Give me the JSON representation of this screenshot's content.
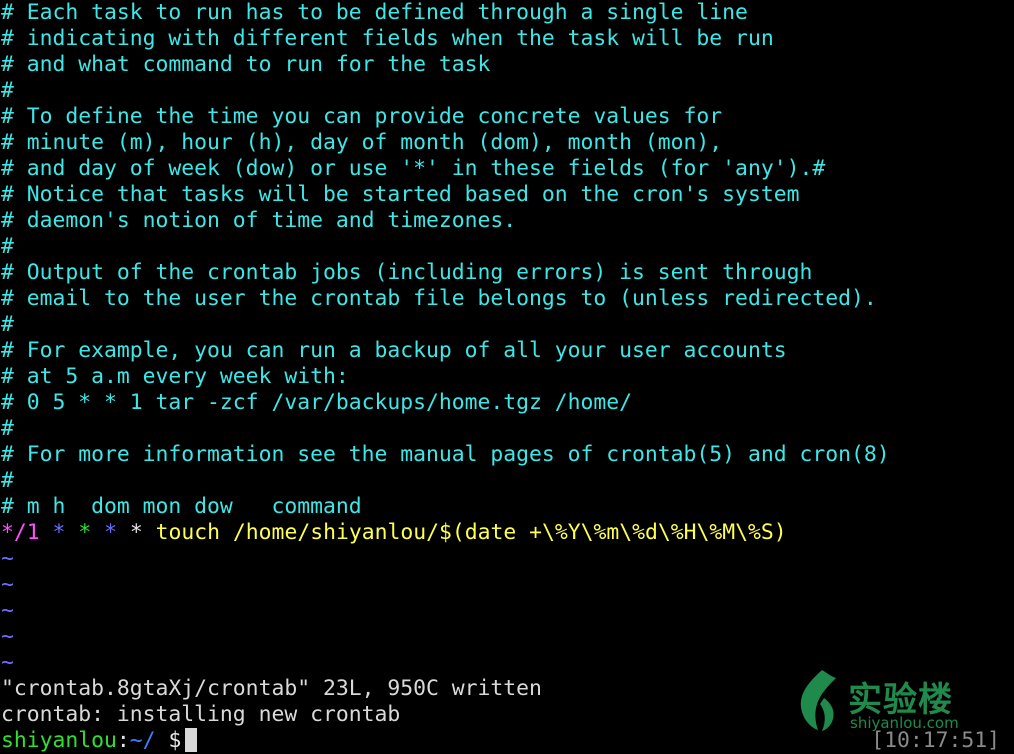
{
  "editor": {
    "comment_lines": [
      "# Each task to run has to be defined through a single line",
      "# indicating with different fields when the task will be run",
      "# and what command to run for the task",
      "#",
      "# To define the time you can provide concrete values for",
      "# minute (m), hour (h), day of month (dom), month (mon),",
      "# and day of week (dow) or use '*' in these fields (for 'any').#",
      "# Notice that tasks will be started based on the cron's system",
      "# daemon's notion of time and timezones.",
      "#",
      "# Output of the crontab jobs (including errors) is sent through",
      "# email to the user the crontab file belongs to (unless redirected).",
      "#",
      "# For example, you can run a backup of all your user accounts",
      "# at 5 a.m every week with:",
      "# 0 5 * * 1 tar -zcf /var/backups/home.tgz /home/",
      "#",
      "# For more information see the manual pages of crontab(5) and cron(8)",
      "#",
      "# m h  dom mon dow   command"
    ],
    "cron_entry": {
      "minute": "*/1",
      "hour": "*",
      "dom": "*",
      "mon": "*",
      "dow": "*",
      "command": "touch /home/shiyanlou/$(date +\\%Y\\%m\\%d\\%H\\%M\\%S)"
    },
    "tilde_lines": [
      "~",
      "~",
      "~",
      "~",
      "~"
    ]
  },
  "status": {
    "write_message": "\"crontab.8gtaXj/crontab\" 23L, 950C written",
    "install_message": "crontab: installing new crontab"
  },
  "prompt": {
    "user": "shiyanlou",
    "separator": ":",
    "path": "~/",
    "symbol": "$"
  },
  "clock": "[10:17:51]",
  "watermark": {
    "title": "实验楼",
    "subtitle": "shiyanlou.com",
    "logo_icon": "shiyanlou-leaf-logo-icon",
    "color": "#1f8a4c"
  },
  "colors": {
    "background": "#000000",
    "comment": "#3ee7e7",
    "tilde": "#6f6fff",
    "status_text": "#d9d9d9"
  }
}
